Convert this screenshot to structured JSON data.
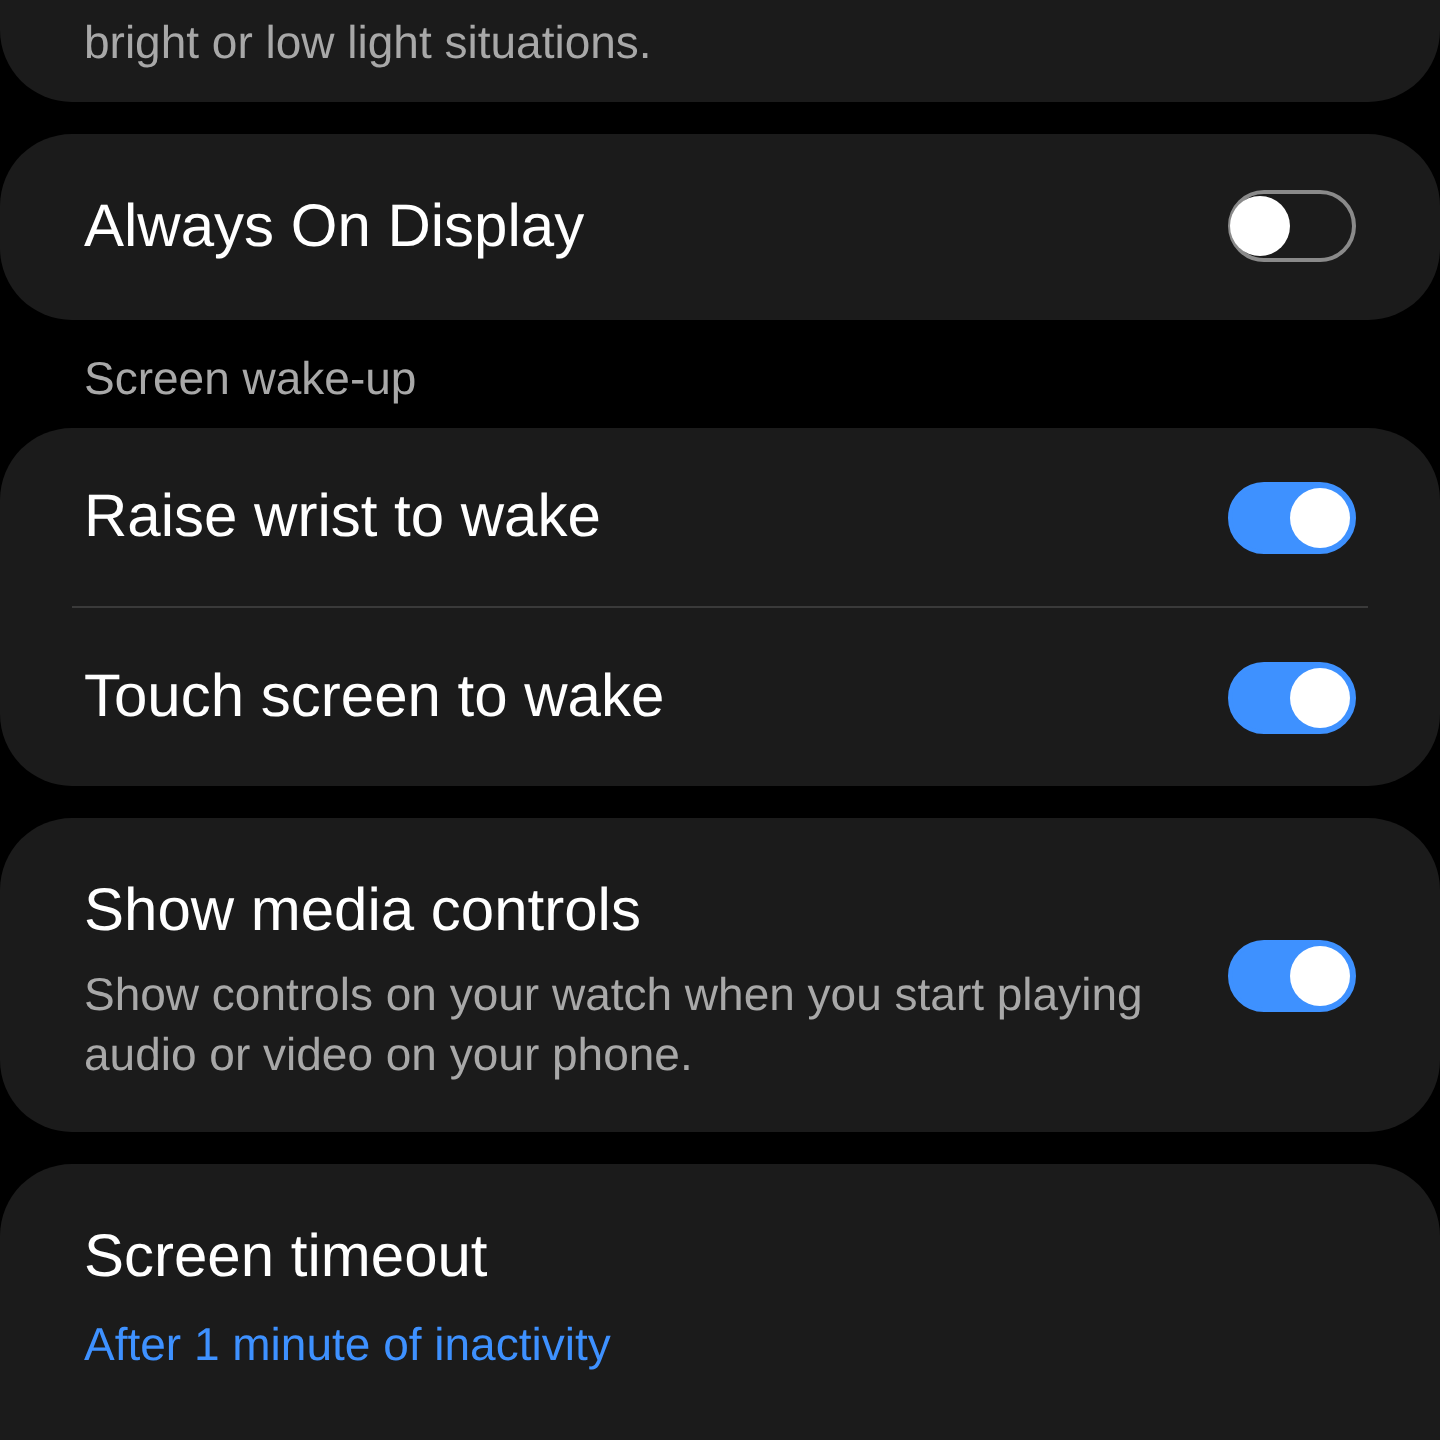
{
  "top_card": {
    "description": "bright or low light situations."
  },
  "always_on_display": {
    "title": "Always On Display",
    "on": false
  },
  "section_label": "Screen wake-up",
  "wake_up": [
    {
      "title": "Raise wrist to wake",
      "on": true
    },
    {
      "title": "Touch screen to wake",
      "on": true
    }
  ],
  "media_controls": {
    "title": "Show media controls",
    "description": "Show controls on your watch when you start playing audio or video on your phone.",
    "on": true
  },
  "screen_timeout": {
    "title": "Screen timeout",
    "value": "After 1 minute of inactivity"
  }
}
